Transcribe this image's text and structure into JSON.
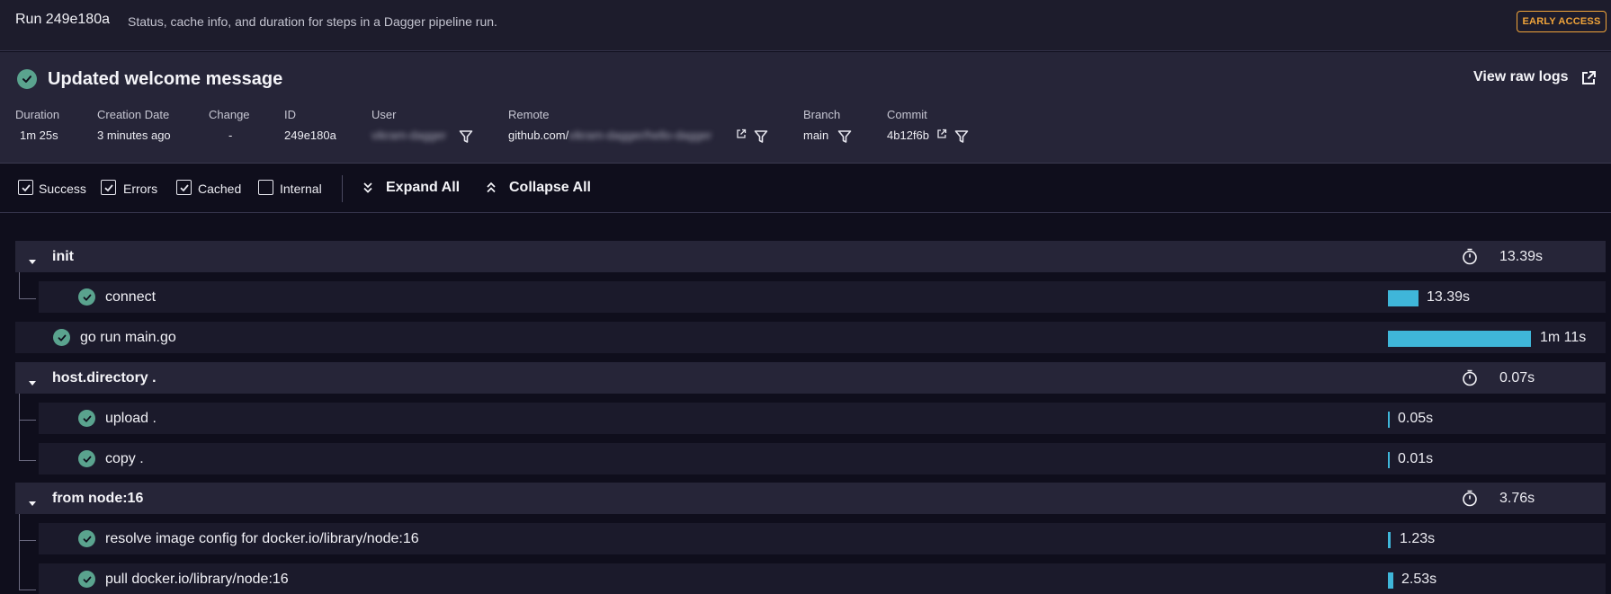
{
  "topbar": {
    "run_title": "Run 249e180a",
    "description": "Status, cache info, and duration for steps in a Dagger pipeline run.",
    "badge": "EARLY ACCESS"
  },
  "header": {
    "status_icon": "check-circle-icon",
    "title": "Updated welcome message",
    "view_raw_logs": "View raw logs",
    "meta": {
      "duration": {
        "label": "Duration",
        "value": "1m 25s"
      },
      "creation_date": {
        "label": "Creation Date",
        "value": "3 minutes ago"
      },
      "change": {
        "label": "Change",
        "value": "-"
      },
      "id": {
        "label": "ID",
        "value": "249e180a"
      },
      "user": {
        "label": "User",
        "value": "vikram-dagger"
      },
      "remote": {
        "label": "Remote",
        "value_prefix": "github.com/",
        "value_blurred": "vikram-dagger/hello-dagger"
      },
      "branch": {
        "label": "Branch",
        "value": "main"
      },
      "commit": {
        "label": "Commit",
        "value": "4b12f6b"
      }
    }
  },
  "toolbar": {
    "filters": [
      {
        "label": "Success",
        "checked": true
      },
      {
        "label": "Errors",
        "checked": true
      },
      {
        "label": "Cached",
        "checked": true
      },
      {
        "label": "Internal",
        "checked": false
      }
    ],
    "expand_all": "Expand All",
    "collapse_all": "Collapse All"
  },
  "steps": {
    "init": {
      "label": "init",
      "duration": "13.39s",
      "children": [
        {
          "label": "connect",
          "duration": "13.39s",
          "bar_fraction": 0.19
        }
      ]
    },
    "go_run": {
      "label": "go run main.go",
      "duration": "1m 11s",
      "bar_fraction": 1.0
    },
    "host_directory": {
      "label": "host.directory .",
      "duration": "0.07s",
      "children": [
        {
          "label": "upload .",
          "duration": "0.05s",
          "bar_fraction": 0.005
        },
        {
          "label": "copy .",
          "duration": "0.01s",
          "bar_fraction": 0.002
        }
      ]
    },
    "from_node": {
      "label": "from node:16",
      "duration": "3.76s",
      "children": [
        {
          "label": "resolve image config for docker.io/library/node:16",
          "duration": "1.23s",
          "bar_fraction": 0.017
        },
        {
          "label": "pull docker.io/library/node:16",
          "duration": "2.53s",
          "bar_fraction": 0.035
        }
      ]
    }
  },
  "colors": {
    "success": "#5aa38e",
    "bar": "#3fb6d9",
    "badge": "#f0a43a"
  }
}
